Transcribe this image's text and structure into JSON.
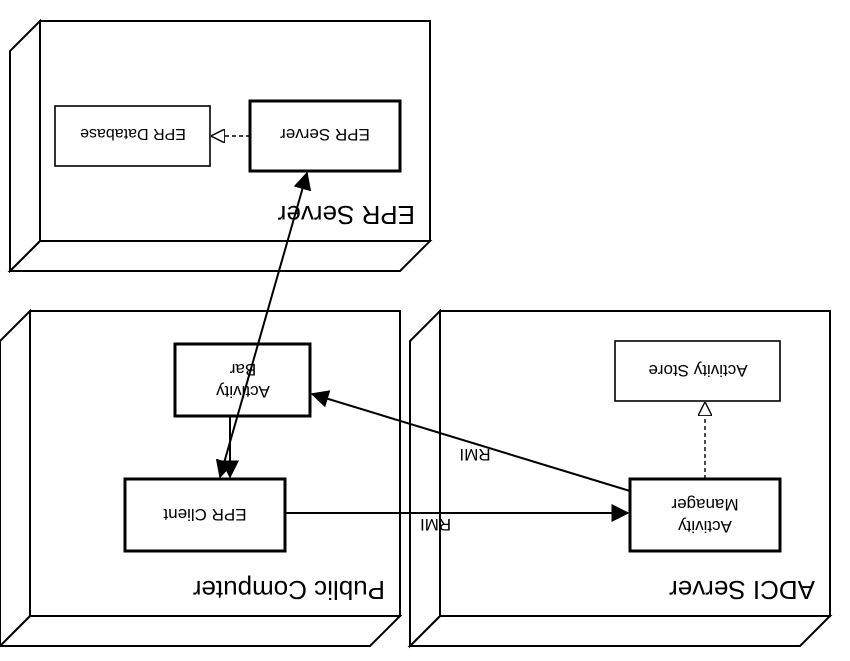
{
  "diagram": {
    "nodes": {
      "adci_server": {
        "title": "ADCI Server",
        "children": {
          "activity_manager": {
            "line1": "Activity",
            "line2": "Manager"
          },
          "activity_store": {
            "label": "Activity Store"
          }
        }
      },
      "public_computer": {
        "title": "Public Computer",
        "children": {
          "activity_bar": {
            "line1": "Activity",
            "line2": "Bar"
          },
          "epr_client": {
            "label": "EPR Client"
          }
        }
      },
      "epr_server_box": {
        "title": "EPR Server",
        "children": {
          "epr_server": {
            "label": "EPR Server"
          },
          "epr_database": {
            "label": "EPR Database"
          }
        }
      }
    },
    "edges": {
      "mgr_to_store": {
        "kind": "dashed-open-arrow"
      },
      "mgr_to_bar": {
        "kind": "solid-arrow",
        "label": "RMI"
      },
      "bar_to_client": {
        "kind": "solid-arrow"
      },
      "client_to_mgr": {
        "kind": "solid-arrow",
        "label": "RMI"
      },
      "client_to_srv": {
        "kind": "solid-double-arrow"
      },
      "srv_to_db": {
        "kind": "dashed-open-arrow"
      }
    }
  }
}
